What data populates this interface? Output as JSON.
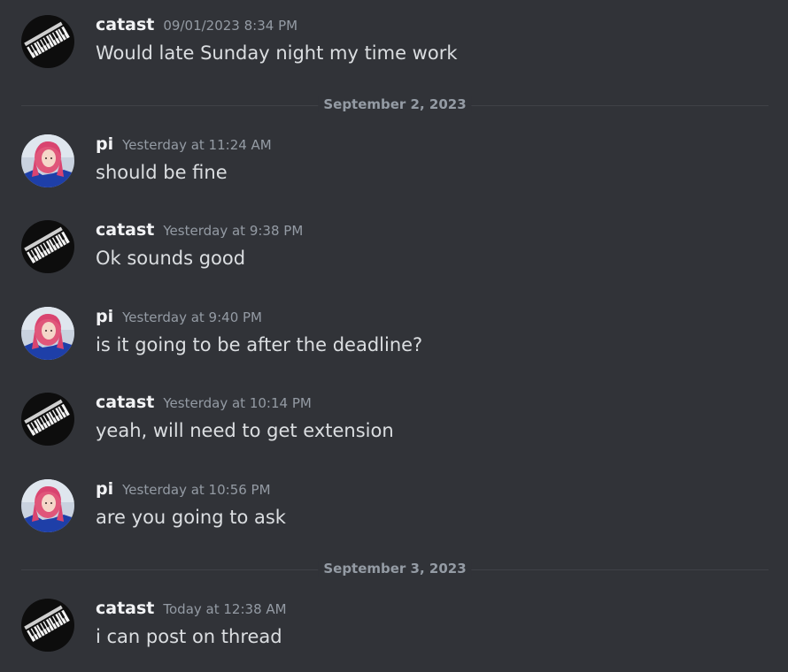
{
  "messages": [
    {
      "author": "catast",
      "timestamp": "09/01/2023 8:34 PM",
      "text": "Would late Sunday night my time work",
      "avatar": "piano-keys-avatar"
    },
    {
      "author": "pi",
      "timestamp": "Yesterday at 11:24 AM",
      "text": "should be fine",
      "avatar": "pink-hair-girl-avatar"
    },
    {
      "author": "catast",
      "timestamp": "Yesterday at 9:38 PM",
      "text": "Ok sounds good",
      "avatar": "piano-keys-avatar"
    },
    {
      "author": "pi",
      "timestamp": "Yesterday at 9:40 PM",
      "text": "is it going to be after the deadline?",
      "avatar": "pink-hair-girl-avatar"
    },
    {
      "author": "catast",
      "timestamp": "Yesterday at 10:14 PM",
      "text": "yeah, will need to get extension",
      "avatar": "piano-keys-avatar"
    },
    {
      "author": "pi",
      "timestamp": "Yesterday at 10:56 PM",
      "text": "are you going to ask",
      "avatar": "pink-hair-girl-avatar"
    },
    {
      "author": "catast",
      "timestamp": "Today at 12:38 AM",
      "text": "i can post on thread",
      "avatar": "piano-keys-avatar"
    }
  ],
  "dividers": [
    "September 2, 2023",
    "September 3, 2023"
  ],
  "colors": {
    "background": "#313338",
    "author": "#f2f3f5",
    "text": "#dbdee1",
    "muted": "#949ba4",
    "divider_line": "#3f4147"
  }
}
